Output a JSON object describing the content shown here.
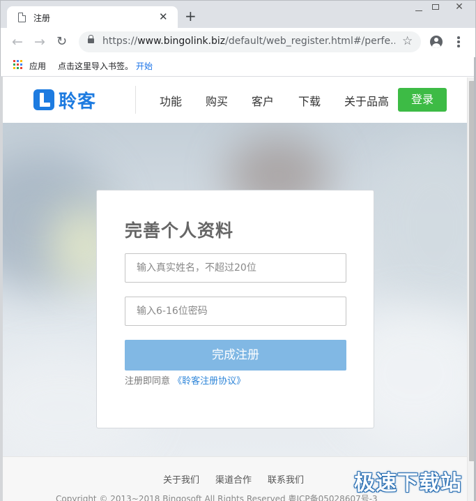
{
  "browser": {
    "tab_title": "注册",
    "tab_close": "✕",
    "new_tab": "+",
    "url_scheme": "https://",
    "url_host": "www.bingolink.biz",
    "url_path": "/default/web_register.html#/perfe...",
    "bookmarks": {
      "apps": "应用",
      "import": "点击这里导入书签。",
      "start": "开始"
    },
    "icons": [
      "file-icon",
      "back-arrow-icon",
      "forward-arrow-icon",
      "reload-icon",
      "lock-icon",
      "star-icon",
      "profile-icon",
      "menu-icon",
      "apps-grid-icon"
    ]
  },
  "site": {
    "logo": "聆客",
    "nav": [
      "功能",
      "购买",
      "客户",
      "下载",
      "关于品高"
    ],
    "login": "登录",
    "accent_color": "#1d7be0",
    "login_color": "#3dbb45"
  },
  "form": {
    "title": "完善个人资料",
    "name_placeholder": "输入真实姓名，不超过20位",
    "password_placeholder": "输入6-16位密码",
    "submit": "完成注册",
    "submit_color": "#81b8e4",
    "agree_text": "注册即同意",
    "agree_link": "《聆客注册协议》"
  },
  "footer": {
    "links": [
      "关于我们",
      "渠道合作",
      "联系我们"
    ],
    "copyright": "Copyright © 2013~2018 Bingosoft All Rights Reserved     粤ICP备05028607号-3"
  },
  "watermark": "极速下载站"
}
